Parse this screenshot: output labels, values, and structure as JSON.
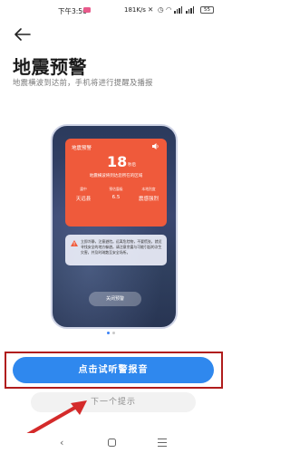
{
  "status_bar": {
    "time": "下午3:56",
    "speed": "181K/s",
    "battery": "55"
  },
  "header": {
    "title": "地震预警",
    "subtitle": "地震横波到达前，手机将进行提醒及播报"
  },
  "phone_preview": {
    "alert": {
      "heading": "地震预警",
      "countdown_value": "18",
      "countdown_unit": "秒后",
      "message": "地震横波将到达您所在的区域",
      "metrics": [
        {
          "label": "震中",
          "value": "天远县"
        },
        {
          "label": "预估震级",
          "value": "6.5"
        },
        {
          "label": "本地烈度",
          "value": "震感强烈"
        }
      ]
    },
    "warning_text": "立即冷静，注意避险。远离危险物，不要慌张，就近寻找安全的地方躲避。请注意余震与可能引起的次生灾害，并及时疏散至安全场所。",
    "close_button": "关闭预警"
  },
  "pagination": {
    "total": 2,
    "active": 0
  },
  "actions": {
    "primary_label": "点击试听警报音",
    "secondary_label": "下一个提示"
  },
  "colors": {
    "accent": "#2f88ee",
    "alert_red": "#ef5a3b",
    "highlight_border": "#b01c1c"
  }
}
